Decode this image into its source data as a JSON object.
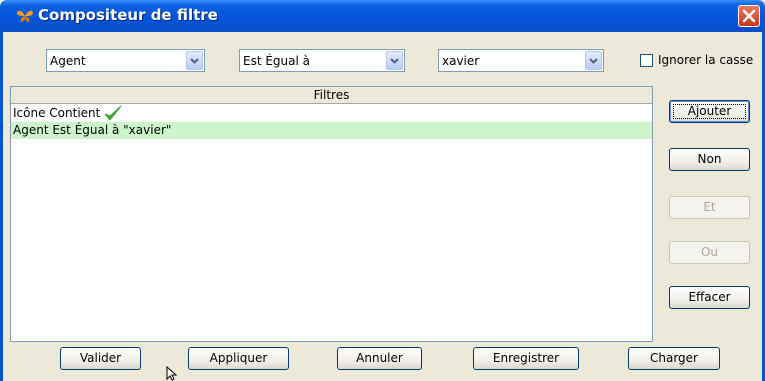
{
  "window": {
    "title": "Compositeur de filtre"
  },
  "criteria": {
    "field": "Agent",
    "operator": "Est Égual à",
    "value": "xavier",
    "ignore_case_label": "Ignorer la casse",
    "ignore_case_checked": false
  },
  "filters": {
    "header": "Filtres",
    "rows": [
      {
        "text": "Icône Contient",
        "icon": "green-check-icon",
        "selected": false
      },
      {
        "text": "Agent Est Égual à \"xavier\"",
        "selected": true
      }
    ]
  },
  "side_buttons": {
    "add": "Ajouter",
    "not": "Non",
    "and": "Et",
    "or": "Ou",
    "clear": "Effacer"
  },
  "bottom_buttons": {
    "validate": "Valider",
    "apply": "Appliquer",
    "cancel": "Annuler",
    "save": "Enregistrer",
    "load": "Charger"
  },
  "colors": {
    "titlebar": "#0553d8",
    "selected_row": "#ccf5cc",
    "close_button": "#c8361b"
  }
}
